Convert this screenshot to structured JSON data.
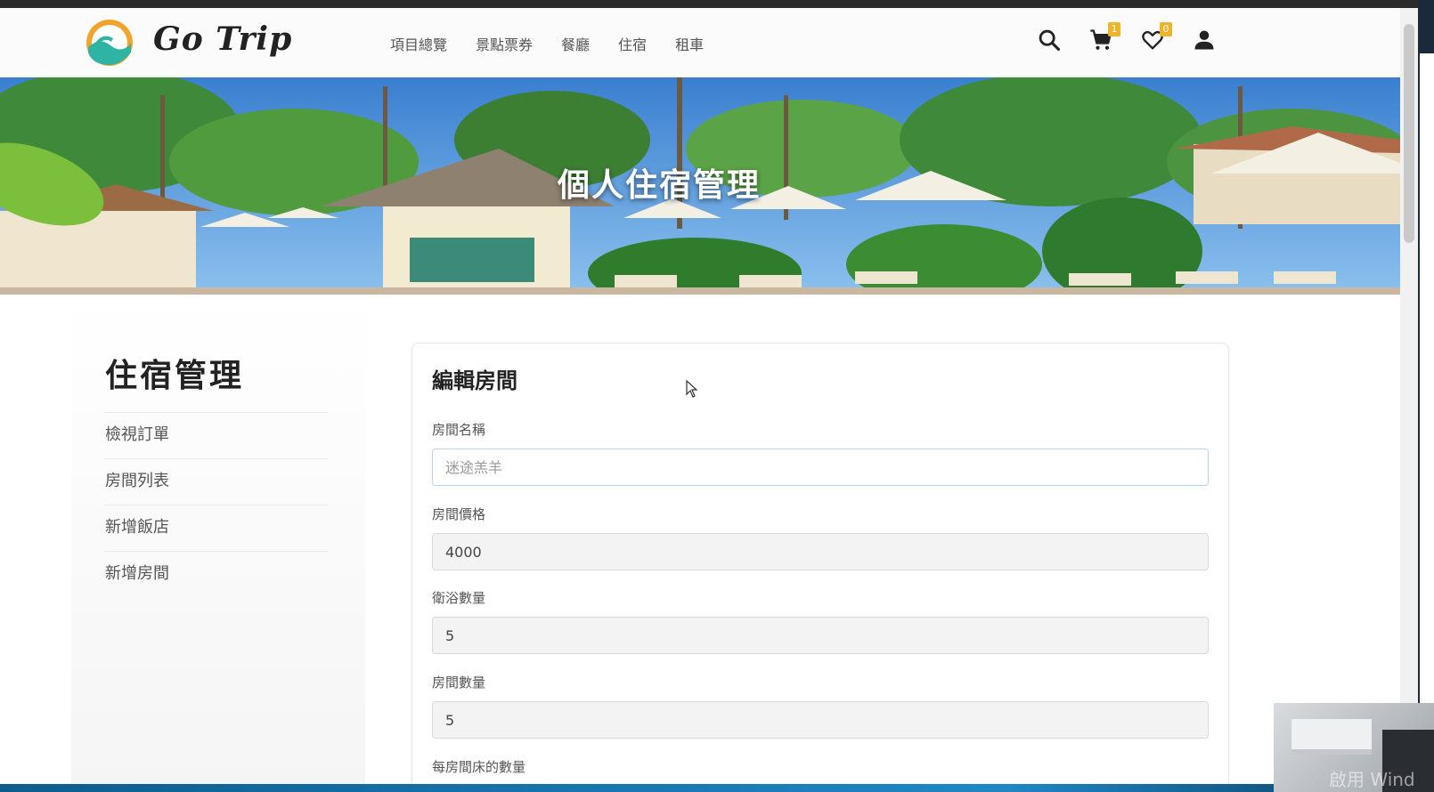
{
  "brand": {
    "name": "Go Trip"
  },
  "nav": {
    "links": [
      "項目總覽",
      "景點票券",
      "餐廳",
      "住宿",
      "租車"
    ],
    "cart_count": "1",
    "wishlist_count": "0"
  },
  "hero": {
    "title": "個人住宿管理"
  },
  "sidebar": {
    "title": "住宿管理",
    "items": [
      "檢視訂單",
      "房間列表",
      "新增飯店",
      "新增房間"
    ]
  },
  "form": {
    "title": "編輯房間",
    "fields": [
      {
        "label": "房間名稱",
        "value": "",
        "placeholder": "迷途羔羊"
      },
      {
        "label": "房間價格",
        "value": "4000"
      },
      {
        "label": "衛浴數量",
        "value": "5"
      },
      {
        "label": "房間數量",
        "value": "5"
      },
      {
        "label": "每房間床的數量"
      }
    ]
  },
  "overlay": {
    "watermark": "啟用 Wind"
  },
  "colors": {
    "badge": "#f0b429",
    "logo_orange": "#f3a32b",
    "logo_teal": "#2fb3a3"
  }
}
